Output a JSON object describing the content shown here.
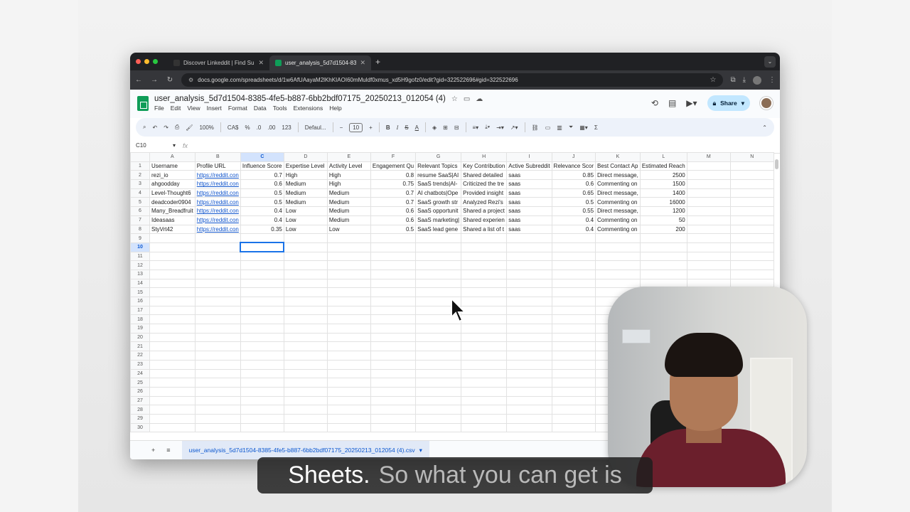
{
  "browser": {
    "tabs": [
      {
        "title": "Discover Linkeddit | Find Sub",
        "active": false
      },
      {
        "title": "user_analysis_5d7d1504-83",
        "active": true
      }
    ],
    "url": "docs.google.com/spreadsheets/d/1w6AfUAayaM2lKhKIAOI60mMuldf0xmus_xd5H9gofz0/edit?gid=322522696#gid=322522696"
  },
  "doc": {
    "title": "user_analysis_5d7d1504-8385-4fe5-b887-6bb2bdf07175_20250213_012054 (4)",
    "menus": [
      "File",
      "Edit",
      "View",
      "Insert",
      "Format",
      "Data",
      "Tools",
      "Extensions",
      "Help"
    ],
    "share_label": "Share"
  },
  "toolbar": {
    "zoom": "100%",
    "currency": "CA$",
    "percent": "%",
    "dec_less": ".0",
    "dec_more": ".00",
    "number_format": "123",
    "font": "Defaul...",
    "font_size": "10",
    "bold": "B",
    "italic": "I",
    "strike": "S",
    "text_color": "A"
  },
  "formula_bar": {
    "cell_ref": "C10",
    "fx": "fx",
    "content": ""
  },
  "grid": {
    "columns": [
      "A",
      "B",
      "C",
      "D",
      "E",
      "F",
      "G",
      "H",
      "I",
      "J",
      "K",
      "L",
      "M",
      "N"
    ],
    "selected_column": "C",
    "selected_row": 10,
    "header": [
      "Username",
      "Profile URL",
      "Influence Score",
      "Expertise Level",
      "Activity Level",
      "Engagement Qu",
      "Relevant Topics",
      "Key Contribution",
      "Active Subreddit",
      "Relevance Scor",
      "Best Contact Ap",
      "Estimated Reach",
      "",
      ""
    ],
    "rows": [
      [
        "rezi_io",
        "https://reddit.con",
        "0.7",
        "High",
        "High",
        "0.8",
        "resume SaaS|AI",
        "Shared detailed",
        "saas",
        "0.85",
        "Direct message,",
        "2500",
        "",
        ""
      ],
      [
        "ahgoodday",
        "https://reddit.con",
        "0.6",
        "Medium",
        "High",
        "0.75",
        "SaaS trends|AI-",
        "Criticized the tre",
        "saas",
        "0.6",
        "Commenting on",
        "1500",
        "",
        ""
      ],
      [
        "Level-Thought6",
        "https://reddit.con",
        "0.5",
        "Medium",
        "Medium",
        "0.7",
        "AI chatbots|Ope",
        "Provided insight",
        "saas",
        "0.65",
        "Direct message,",
        "1400",
        "",
        ""
      ],
      [
        "deadcoder0904",
        "https://reddit.con",
        "0.5",
        "Medium",
        "Medium",
        "0.7",
        "SaaS growth str",
        "Analyzed Rezi's",
        "saas",
        "0.5",
        "Commenting on",
        "16000",
        "",
        ""
      ],
      [
        "Many_Breadfruit",
        "https://reddit.con",
        "0.4",
        "Low",
        "Medium",
        "0.6",
        "SaaS opportunit",
        "Shared a project",
        "saas",
        "0.55",
        "Direct message,",
        "1200",
        "",
        ""
      ],
      [
        "Ideasaas",
        "https://reddit.con",
        "0.4",
        "Low",
        "Medium",
        "0.6",
        "SaaS marketing|",
        "Shared experien",
        "saas",
        "0.4",
        "Commenting on",
        "50",
        "",
        ""
      ],
      [
        "StyVrt42",
        "https://reddit.con",
        "0.35",
        "Low",
        "Low",
        "0.5",
        "SaaS lead gene",
        "Shared a list of t",
        "saas",
        "0.4",
        "Commenting on",
        "200",
        "",
        ""
      ]
    ],
    "total_rows": 30
  },
  "sheet_tab": {
    "name": "user_analysis_5d7d1504-8385-4fe5-b887-6bb2bdf07175_20250213_012054 (4).csv"
  },
  "caption": {
    "spoken": "Sheets.",
    "upcoming": "So what you can get is"
  },
  "colors": {
    "sheets_green": "#0f9d58",
    "selection_blue": "#1a73e8",
    "share_bg": "#c2e7ff"
  }
}
